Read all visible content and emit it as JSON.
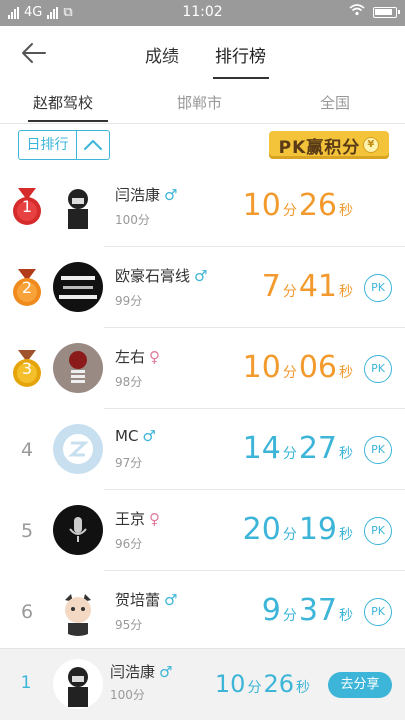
{
  "status_bar": {
    "network": "4G",
    "time": "11:02"
  },
  "header": {
    "tabs": [
      "成绩",
      "排行榜"
    ],
    "active_tab": "排行榜"
  },
  "sub_tabs": [
    "赵都驾校",
    "邯郸市",
    "全国"
  ],
  "filter": {
    "label": "日排行"
  },
  "pk_banner": {
    "text": "PK赢积分",
    "coin": "¥"
  },
  "units": {
    "minute": "分",
    "second": "秒"
  },
  "pk_label": "PK",
  "rows": [
    {
      "rank": "1",
      "name": "闫浩康",
      "gender": "♂",
      "score": "100分",
      "minutes": "10",
      "seconds": "26",
      "medal": "red",
      "color": "orange"
    },
    {
      "rank": "2",
      "name": "欧豪石膏线",
      "gender": "♂",
      "score": "99分",
      "minutes": "7",
      "seconds": "41",
      "medal": "orange",
      "color": "orange"
    },
    {
      "rank": "3",
      "name": "左右",
      "gender": "♀",
      "score": "98分",
      "minutes": "10",
      "seconds": "06",
      "medal": "gold",
      "color": "orange"
    },
    {
      "rank": "4",
      "name": "MC",
      "gender": "♂",
      "score": "97分",
      "minutes": "14",
      "seconds": "27",
      "color": "blue"
    },
    {
      "rank": "5",
      "name": "王京",
      "gender": "♀",
      "score": "96分",
      "minutes": "20",
      "seconds": "19",
      "color": "blue"
    },
    {
      "rank": "6",
      "name": "贺培蕾",
      "gender": "♂",
      "score": "95分",
      "minutes": "9",
      "seconds": "37",
      "color": "blue"
    }
  ],
  "me": {
    "rank": "1",
    "name": "闫浩康",
    "gender": "♂",
    "score": "100分",
    "minutes": "10",
    "seconds": "26",
    "share_label": "去分享"
  },
  "colors": {
    "accent": "#3cb5d8",
    "orange": "#f39a2e",
    "status_bar": "#9a9a9a"
  }
}
